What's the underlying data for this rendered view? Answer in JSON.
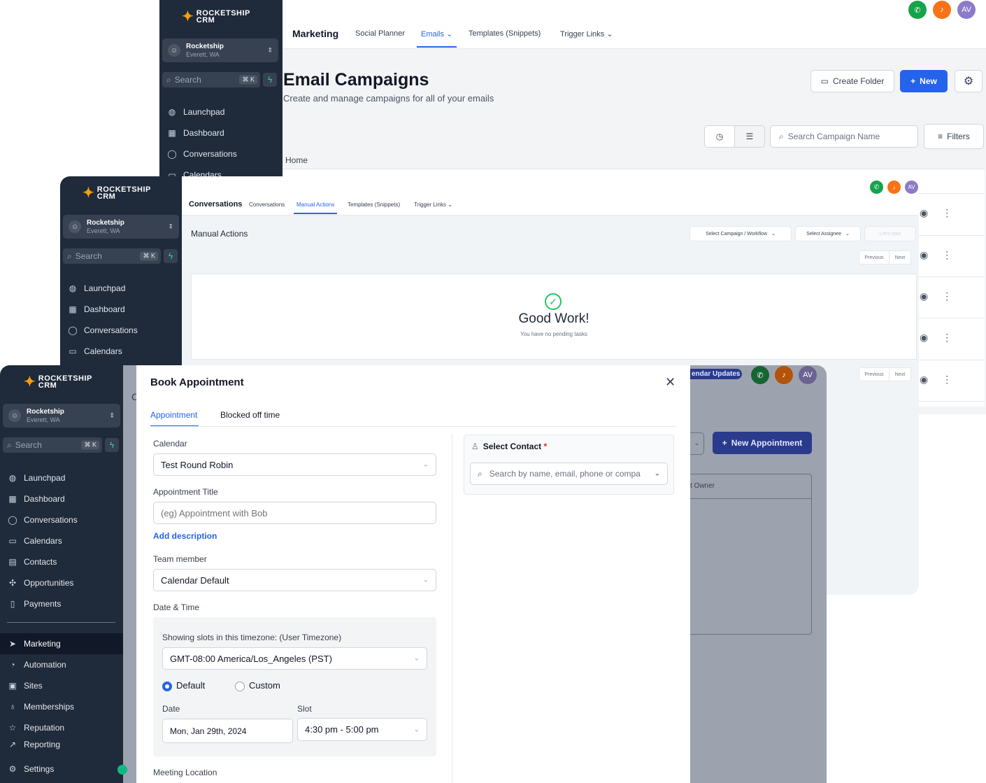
{
  "brand": {
    "line1": "ROCKETSHIP",
    "line2": "CRM"
  },
  "location": {
    "name": "Rocketship",
    "city": "Everett, WA"
  },
  "sidebar_search": {
    "placeholder": "Search",
    "shortcut": "⌘ K"
  },
  "avatar_initials": "AV",
  "win1": {
    "sidebar_items": [
      "Launchpad",
      "Dashboard",
      "Conversations",
      "Calendars"
    ],
    "section": "Marketing",
    "tabs": [
      "Social Planner",
      "Emails",
      "Templates (Snippets)",
      "Trigger Links"
    ],
    "title": "Email Campaigns",
    "subtitle": "Create and manage campaigns for all of your emails",
    "create_folder": "Create Folder",
    "new": "New",
    "search_placeholder": "Search Campaign Name",
    "filters": "Filters",
    "breadcrumb": "Home"
  },
  "win2": {
    "sidebar_items": [
      "Launchpad",
      "Dashboard",
      "Conversations",
      "Calendars"
    ],
    "section": "Conversations",
    "tabs": [
      "Conversations",
      "Manual Actions",
      "Templates (Snippets)",
      "Trigger Links"
    ],
    "page_title": "Manual Actions",
    "select_campaign": "Select Campaign / Workflow",
    "select_assignee": "Select Assignee",
    "lets_start": "Let's start",
    "previous": "Previous",
    "next": "Next",
    "empty_title": "Good Work!",
    "empty_sub": "You have no pending tasks"
  },
  "win3": {
    "sidebar_items": [
      "Launchpad",
      "Dashboard",
      "Conversations",
      "Calendars",
      "Contacts",
      "Opportunities",
      "Payments"
    ],
    "sidebar_items2": [
      "Marketing",
      "Automation",
      "Sites",
      "Memberships",
      "Reputation",
      "Reporting"
    ],
    "settings": "Settings",
    "calendar_updates": "endar Updates",
    "new_appointment": "New Appointment",
    "owner_col": "t Owner"
  },
  "modal": {
    "title": "Book Appointment",
    "tabs": [
      "Appointment",
      "Blocked off time"
    ],
    "calendar_label": "Calendar",
    "calendar_value": "Test Round Robin",
    "title_label": "Appointment Title",
    "title_placeholder": "(eg) Appointment with Bob",
    "add_description": "Add description",
    "team_label": "Team member",
    "team_value": "Calendar Default",
    "datetime_label": "Date & Time",
    "tz_label": "Showing slots in this timezone: (User Timezone)",
    "tz_value": "GMT-08:00 America/Los_Angeles (PST)",
    "radio_default": "Default",
    "radio_custom": "Custom",
    "date_label": "Date",
    "date_value": "Mon, Jan 29th, 2024",
    "slot_label": "Slot",
    "slot_value": "4:30 pm - 5:00 pm",
    "meeting_label": "Meeting Location",
    "contact_label": "Select Contact",
    "contact_required": "*",
    "contact_placeholder": "Search by name, email, phone or compa"
  }
}
